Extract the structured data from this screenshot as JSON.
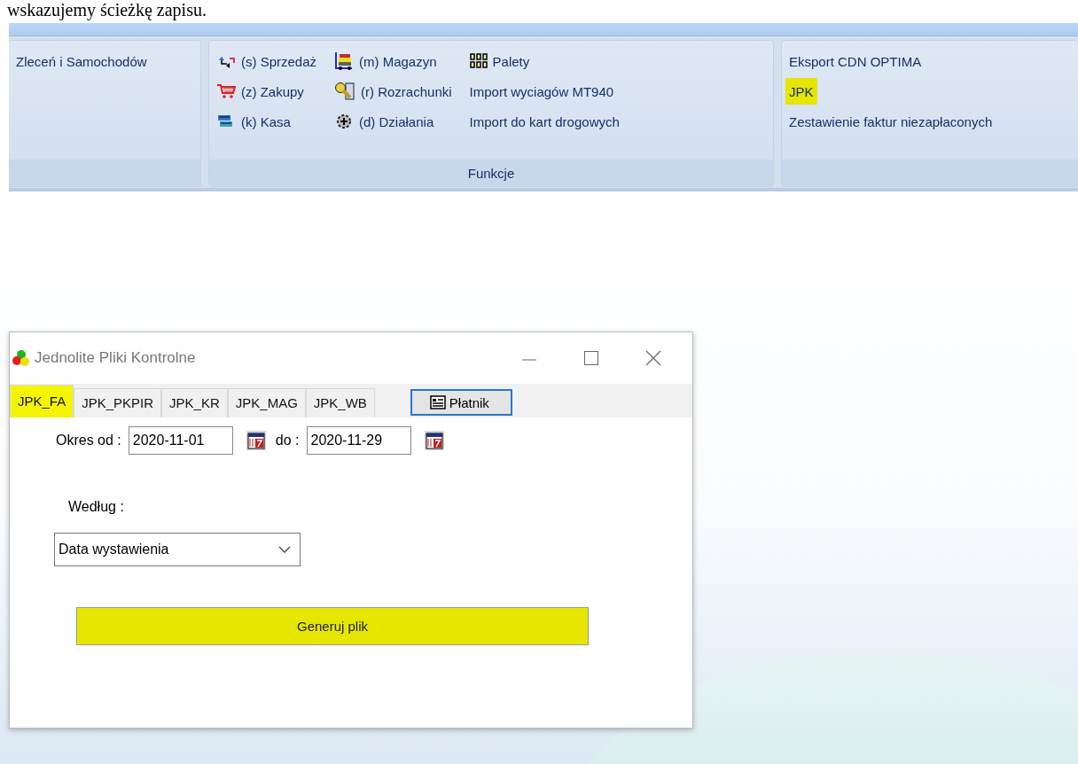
{
  "caption": "wskazujemy ścieżkę zapisu.",
  "ribbon": {
    "groups": [
      {
        "columns": [
          [
            {
              "label": "Zleceń i Samochodów",
              "kind": "text",
              "highlighted": false
            }
          ]
        ]
      },
      {
        "label": "Funkcje",
        "columns": [
          [
            {
              "label": "(s) Sprzedaż",
              "kind": "sale",
              "highlighted": false
            },
            {
              "label": "(z) Zakupy",
              "kind": "cart",
              "highlighted": false
            },
            {
              "label": "(k) Kasa",
              "kind": "cash",
              "highlighted": false
            }
          ],
          [
            {
              "label": "(m) Magazyn",
              "kind": "store",
              "highlighted": false
            },
            {
              "label": "(r) Rozrachunki",
              "kind": "key",
              "highlighted": false
            },
            {
              "label": "(d) Działania",
              "kind": "gear",
              "highlighted": false
            }
          ],
          [
            {
              "label": "Palety",
              "kind": "grid",
              "highlighted": false
            },
            {
              "label": "Import wyciagów MT940",
              "kind": "text",
              "highlighted": false
            },
            {
              "label": "Import do kart drogowych",
              "kind": "text",
              "highlighted": false
            }
          ]
        ]
      },
      {
        "columns": [
          [
            {
              "label": "Eksport CDN OPTIMA",
              "kind": "text",
              "highlighted": false
            },
            {
              "label": "JPK",
              "kind": "text",
              "highlighted": true
            },
            {
              "label": "Zestawienie faktur niezapłaconych",
              "kind": "text",
              "highlighted": false
            }
          ]
        ]
      }
    ]
  },
  "dialog": {
    "title": "Jednolite Pliki Kontrolne",
    "tabs": [
      {
        "label": "JPK_FA",
        "selected": true,
        "highlighted": true
      },
      {
        "label": "JPK_PKPIR",
        "selected": false,
        "highlighted": false
      },
      {
        "label": "JPK_KR",
        "selected": false,
        "highlighted": false
      },
      {
        "label": "JPK_MAG",
        "selected": false,
        "highlighted": false
      },
      {
        "label": "JPK_WB",
        "selected": false,
        "highlighted": false
      }
    ],
    "payer_button": "Płatnik",
    "period": {
      "from_label": "Okres od :",
      "from": "2020-11-01",
      "to_label": "do :",
      "to": "2020-11-29"
    },
    "by_label": "Według :",
    "by_value": "Data wystawienia",
    "generate_button": {
      "label": "Generuj plik",
      "highlighted": true
    }
  }
}
